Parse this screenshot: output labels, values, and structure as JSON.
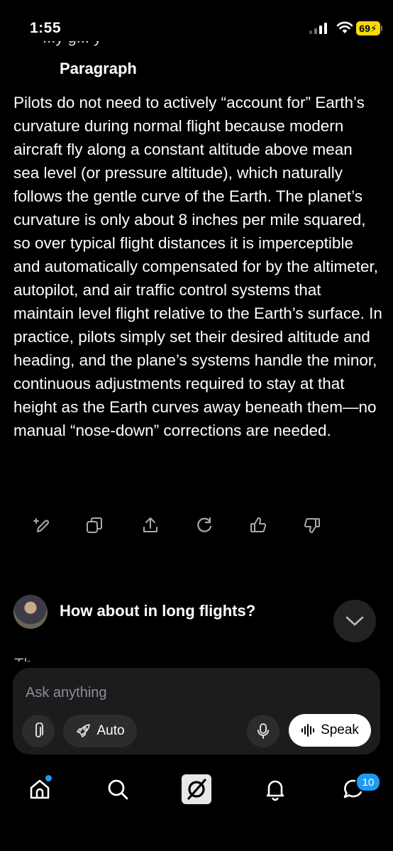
{
  "status_bar": {
    "time": "1:55",
    "battery": "69"
  },
  "chat": {
    "clipped_top_text": "...y g... y",
    "paragraph_label": "Paragraph",
    "answer_text": "Pilots do not need to actively “account for” Earth’s curvature during normal flight because modern aircraft fly along a constant altitude above mean sea level (or pressure altitude), which naturally follows the gentle curve of the Earth. The planet’s curvature is only about 8 inches per mile squared, so over typical flight distances it is imperceptible and automatically compensated for by the altimeter, autopilot, and air traffic control systems that maintain level flight relative to the Earth’s surface. In practice, pilots simply set their desired altitude and heading, and the plane’s systems handle the minor, continuous adjustments required to stay at that height as the Earth curves away beneath them—no manual “nose-down” corrections are needed.",
    "actions": [
      "edit-icon",
      "copy-icon",
      "share-icon",
      "regenerate-icon",
      "thumbs-up-icon",
      "thumbs-down-icon"
    ],
    "user_question": "How about in long flights?",
    "clipped_bottom_text": "Th..."
  },
  "composer": {
    "placeholder": "Ask anything",
    "auto_label": "Auto",
    "speak_label": "Speak"
  },
  "bottom_nav": {
    "items": [
      "home-icon",
      "search-icon",
      "grok-icon",
      "notifications-icon",
      "messages-icon"
    ],
    "messages_badge": "10"
  },
  "colors": {
    "accent": "#1d9bf0",
    "battery": "#f5d90a",
    "composer_bg": "#1c1c1e"
  }
}
